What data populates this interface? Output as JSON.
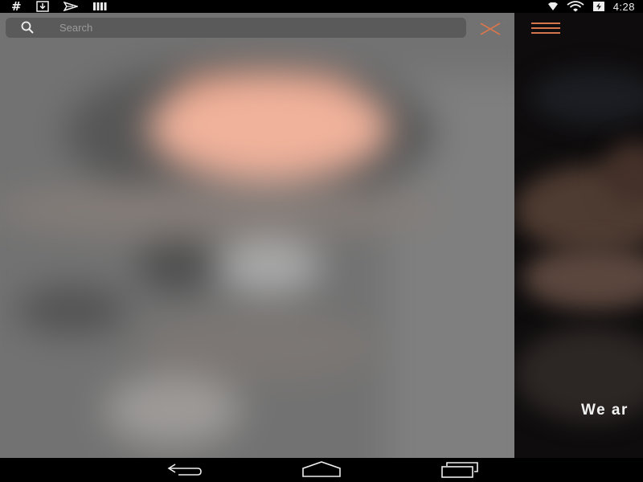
{
  "status_bar": {
    "icons": [
      "hash-icon",
      "download-icon",
      "airplane-icon",
      "signal-bars-icon"
    ],
    "right_icons": [
      "location-icon",
      "wifi-icon",
      "battery-icon"
    ],
    "time": "4:28"
  },
  "drawer": {
    "search": {
      "placeholder": "Search",
      "value": ""
    },
    "close_icon": "close-icon"
  },
  "content": {
    "menu_icon": "hamburger-menu-icon",
    "welcome_text": "We ar"
  },
  "nav_bar": {
    "buttons": [
      "back-icon",
      "home-icon",
      "recents-icon"
    ]
  },
  "colors": {
    "accent": "#d4764d",
    "status_bar_bg": "#000000",
    "drawer_overlay": "#6e6e6e"
  }
}
